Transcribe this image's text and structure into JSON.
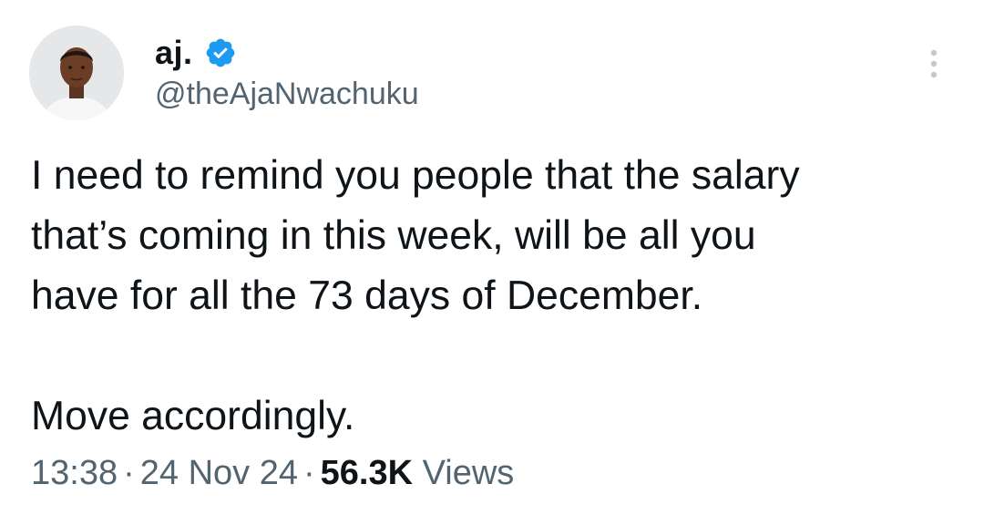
{
  "author": {
    "display_name": "aj.",
    "handle": "@theAjaNwachuku",
    "verified_icon": "verified-badge-icon",
    "avatar_icon": "profile-photo"
  },
  "tweet": {
    "text": "I need to remind you people that the salary\nthat’s coming in this week, will be all you\nhave for all the 73 days of December.\n\nMove accordingly."
  },
  "meta": {
    "time": "13:38",
    "separator": "·",
    "date": "24 Nov 24",
    "views_count": "56.3K",
    "views_label": "Views"
  },
  "menu": {
    "icon": "more-vertical-icon"
  },
  "colors": {
    "text": "#0f1419",
    "secondary": "#536471",
    "verified": "#1d9bf0",
    "background": "#ffffff"
  }
}
